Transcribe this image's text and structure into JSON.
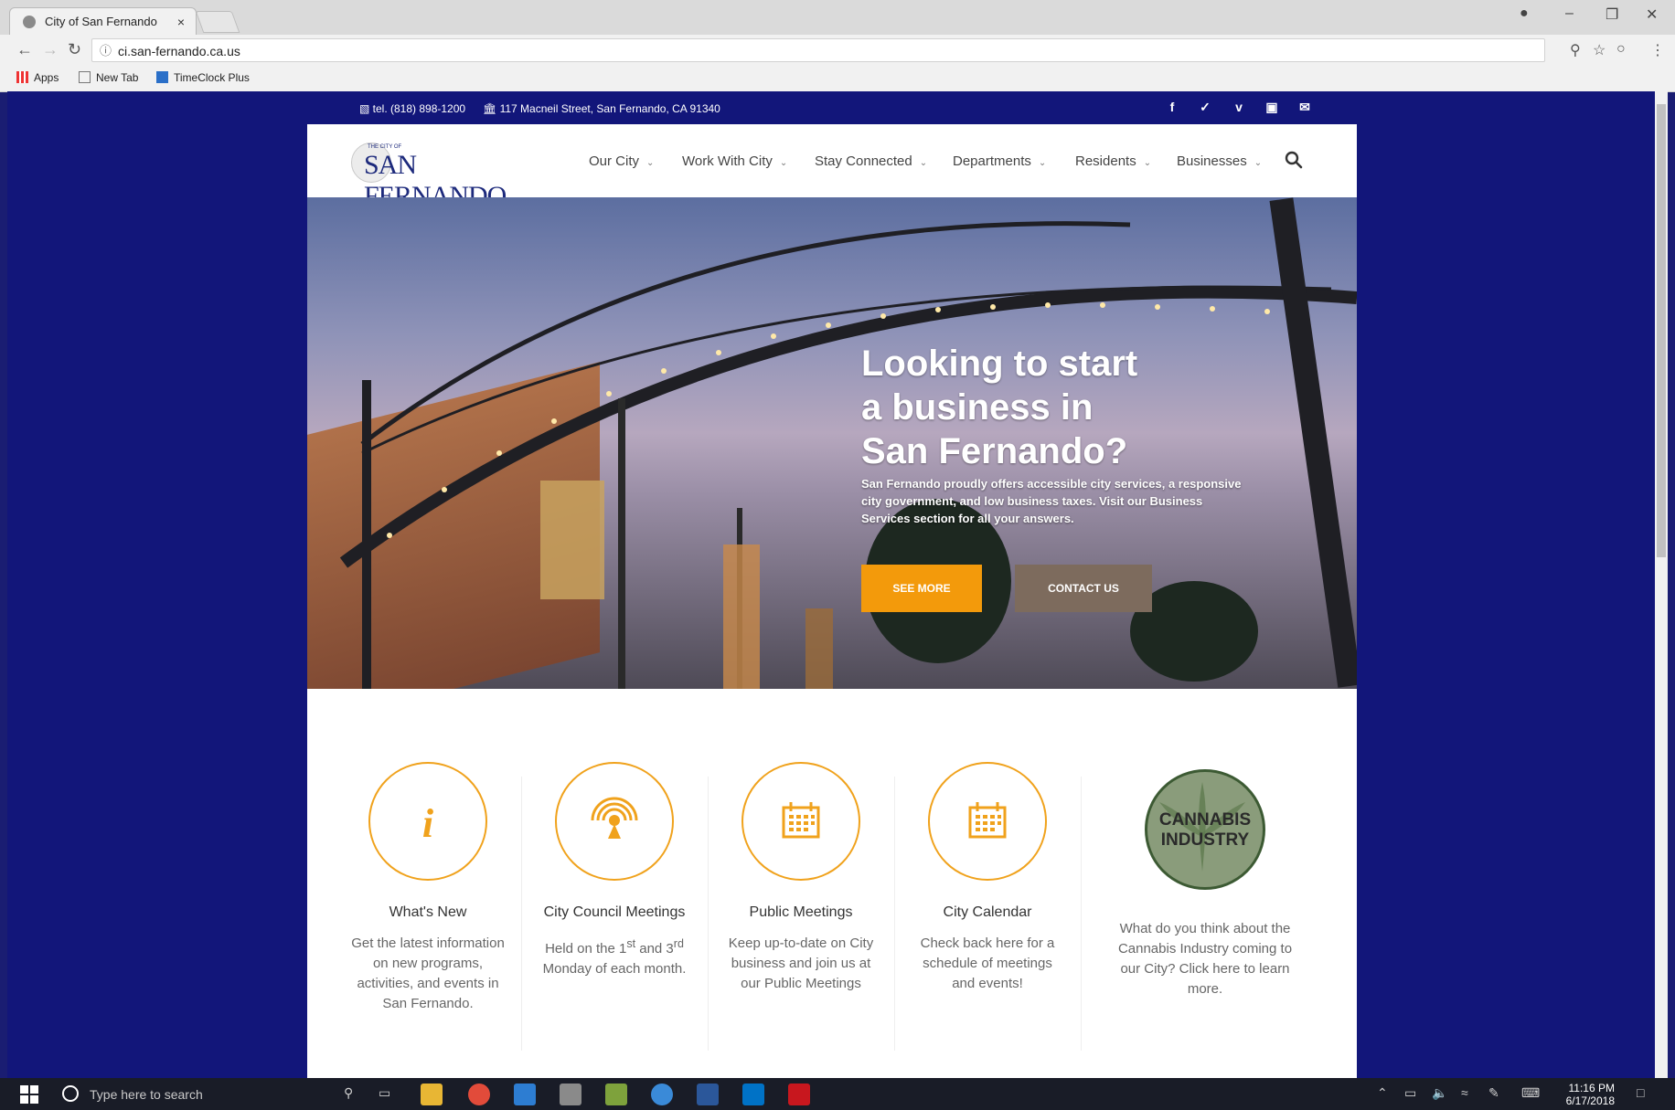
{
  "browser": {
    "tab_title": "City of San Fernando",
    "tab_close": "×",
    "url": "ci.san-fernando.ca.us",
    "bookmarks": [
      "Apps",
      "New Tab",
      "TimeClock Plus"
    ]
  },
  "site": {
    "topbar": {
      "phone": "tel. (818) 898-1200",
      "address": "117 Macneil Street, San Fernando, CA 91340",
      "social_icons": [
        "facebook-icon",
        "twitter-icon",
        "vimeo-icon",
        "instagram-icon",
        "email-icon"
      ]
    },
    "logo": {
      "small_text": "THE CITY OF",
      "text": "SAN FERNANDO"
    },
    "nav": {
      "items": [
        "Our City",
        "Work With City",
        "Stay Connected",
        "Departments",
        "Residents",
        "Businesses"
      ],
      "chevron": "⌄"
    },
    "hero": {
      "headline_line1": "Looking to start",
      "headline_line2": "a business in",
      "headline_line3": "San Fernando?",
      "body": "San Fernando proudly offers accessible city services, a responsive city government, and low business taxes. Visit our Business Services section for all your answers.",
      "see_more": "SEE MORE",
      "contact_us": "CONTACT US"
    },
    "features": [
      {
        "title": "What's New",
        "desc": "Get the latest information on new programs, activities, and events in San Fernando."
      },
      {
        "title": "City Council Meetings",
        "desc_pre": "Held on the 1",
        "sup1": "st",
        "desc_mid": " and 3",
        "sup2": "rd",
        "desc_post": " Monday of each month."
      },
      {
        "title": "Public Meetings",
        "desc": "Keep up-to-date on City business and join us at our Public Meetings"
      },
      {
        "title": "City Calendar",
        "desc": "Check back here for a schedule of meetings and events!"
      },
      {
        "badge_line1": "CANNABIS",
        "badge_line2": "INDUSTRY",
        "desc": "What do you think about the Cannabis Industry coming to our City? Click here to learn more."
      }
    ],
    "accent_color": "#f39a0b",
    "background_color": "#12167a"
  },
  "taskbar": {
    "search_placeholder": "Type here to search",
    "time": "11:16 PM",
    "date": "6/17/2018"
  }
}
